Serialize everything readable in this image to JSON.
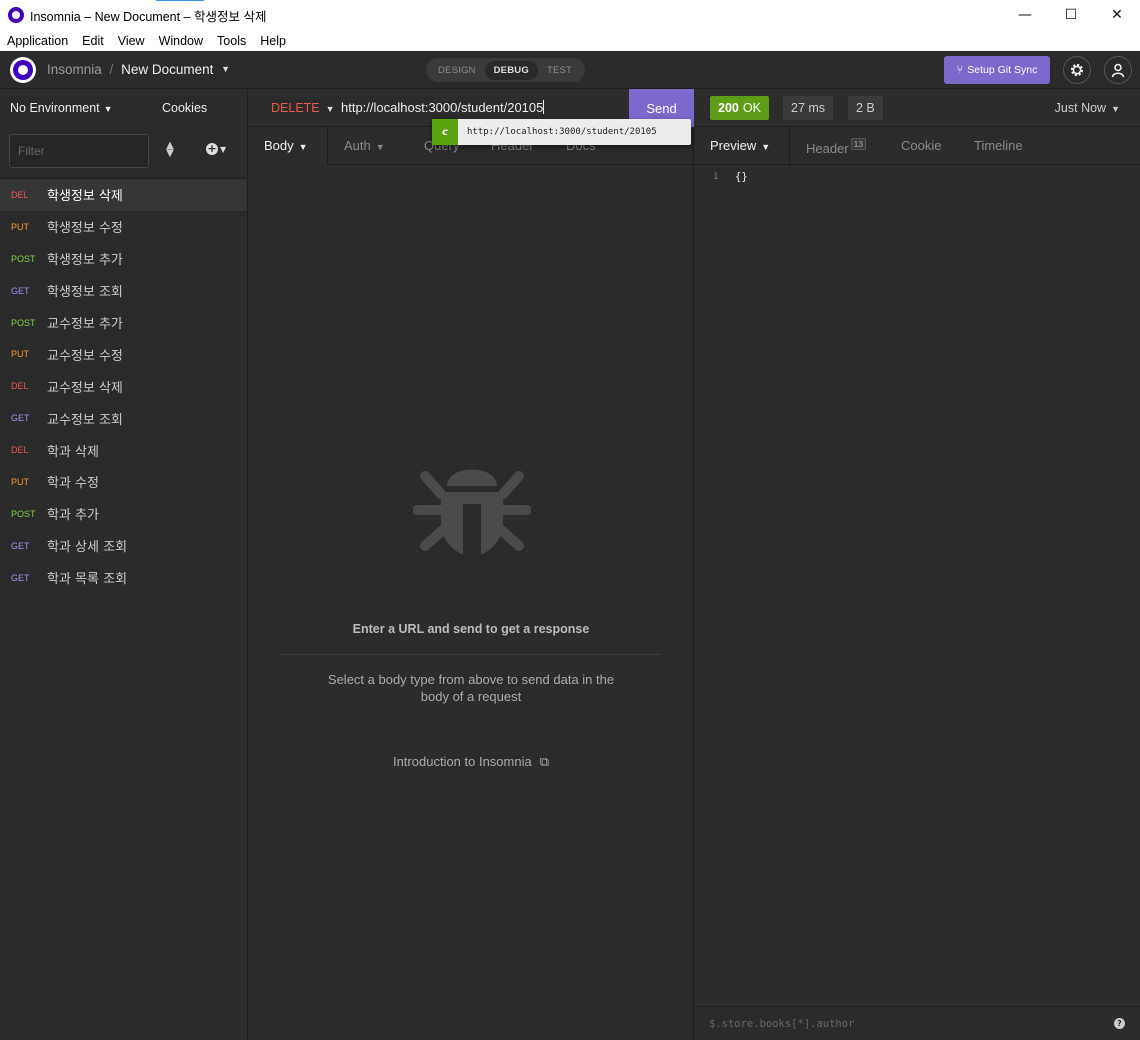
{
  "window": {
    "title": "Insomnia – New Document – 학생정보 삭제",
    "controls": {
      "minimize": "—",
      "maximize": "☐",
      "close": "✕"
    }
  },
  "menu": [
    "Application",
    "Edit",
    "View",
    "Window",
    "Tools",
    "Help"
  ],
  "header": {
    "app_name": "Insomnia",
    "separator": "/",
    "document": "New Document",
    "modes": [
      "DESIGN",
      "DEBUG",
      "TEST"
    ],
    "active_mode": "DEBUG",
    "git_sync_label": "Setup Git Sync"
  },
  "sidebar": {
    "environment": "No Environment",
    "cookies": "Cookies",
    "filter_placeholder": "Filter",
    "requests": [
      {
        "method": "DEL",
        "name": "학생정보 삭제",
        "active": true
      },
      {
        "method": "PUT",
        "name": "학생정보 수정"
      },
      {
        "method": "POST",
        "name": "학생정보 추가"
      },
      {
        "method": "GET",
        "name": "학생정보 조회"
      },
      {
        "method": "POST",
        "name": "교수정보 추가"
      },
      {
        "method": "PUT",
        "name": "교수정보 수정"
      },
      {
        "method": "DEL",
        "name": "교수정보 삭제"
      },
      {
        "method": "GET",
        "name": "교수정보 조회"
      },
      {
        "method": "DEL",
        "name": "학과 삭제"
      },
      {
        "method": "PUT",
        "name": "학과 수정"
      },
      {
        "method": "POST",
        "name": "학과 추가"
      },
      {
        "method": "GET",
        "name": "학과 상세 조회"
      },
      {
        "method": "GET",
        "name": "학과 목록 조회"
      }
    ]
  },
  "request": {
    "method": "DELETE",
    "url": "http://localhost:3000/student/20105",
    "send_label": "Send",
    "autocomplete": {
      "tag": "c",
      "suggestion": "http://localhost:3000/student/20105"
    },
    "tabs": [
      "Body",
      "Auth",
      "Query",
      "Header",
      "Docs"
    ],
    "empty": {
      "title": "Enter a URL and send to get a response",
      "description": "Select a body type from above to send data in the body of a request",
      "intro_link": "Introduction to Insomnia"
    }
  },
  "response": {
    "status_code": "200",
    "status_text": "OK",
    "time": "27 ms",
    "size": "2 B",
    "when": "Just Now",
    "tabs": [
      "Preview",
      "Header",
      "Cookie",
      "Timeline"
    ],
    "header_count": "13",
    "lines": [
      {
        "n": "1",
        "text": "{}"
      }
    ],
    "filter_placeholder": "$.store.books[*].author",
    "help": "?"
  },
  "colors": {
    "accent": "#7d69cb",
    "ok": "#5c9e18",
    "del": "#e35a4f",
    "put": "#f39a2b",
    "post": "#7fd14a",
    "get": "#a08eed"
  }
}
